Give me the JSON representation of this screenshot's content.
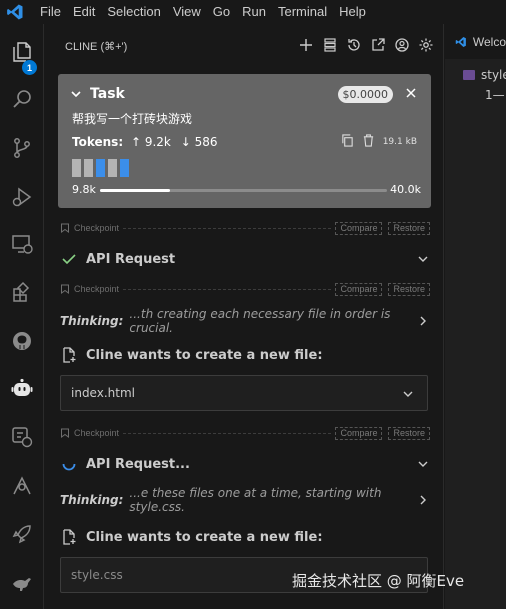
{
  "menubar": {
    "items": [
      "File",
      "Edit",
      "Selection",
      "View",
      "Go",
      "Run",
      "Terminal",
      "Help"
    ]
  },
  "activitybar": {
    "explorer_badge": "1",
    "icons": [
      "files-icon",
      "search-icon",
      "source-control-icon",
      "run-debug-icon",
      "remote-explorer-icon",
      "extensions-icon",
      "github-icon",
      "cline-robot-icon",
      "remote-tunnel-icon",
      "git-graph-icon",
      "deploy-rocket-icon",
      "kangaroo-icon"
    ]
  },
  "sidebar": {
    "title": "CLINE (⌘+')",
    "tools": [
      "plus-icon",
      "server-icon",
      "history-icon",
      "popout-icon",
      "account-icon",
      "gear-icon"
    ]
  },
  "task": {
    "heading": "Task",
    "cost": "$0.0000",
    "text": "帮我写一个打砖块游戏",
    "tokens_label": "Tokens:",
    "tokens_in": "9.2k",
    "tokens_out": "586",
    "size": "19.1 kB",
    "context_used": "9.8k",
    "context_max": "40.0k",
    "context_fraction": 0.245
  },
  "checkpoint": {
    "label": "Checkpoint",
    "compare": "Compare",
    "restore": "Restore"
  },
  "messages": {
    "api_done": "API Request",
    "thinking_label": "Thinking:",
    "thinking_1": "...th creating each necessary file in order is crucial.",
    "new_file_1": "Cline wants to create a new file:",
    "file_1": "index.html",
    "api_pending": "API Request...",
    "thinking_2": "...e these files one at a time, starting with style.css.",
    "new_file_2": "Cline wants to create a new file:",
    "file_2": "style.css"
  },
  "editor": {
    "tab": "Welco",
    "file": "style",
    "line": "1—"
  },
  "watermark": "掘金技术社区 @ 阿衡Eve",
  "colors": {
    "accent": "#0078d4",
    "success": "#89d185",
    "card": "#656565",
    "block_gray": "#b4b4b4",
    "block_blue": "#3b8eea"
  }
}
